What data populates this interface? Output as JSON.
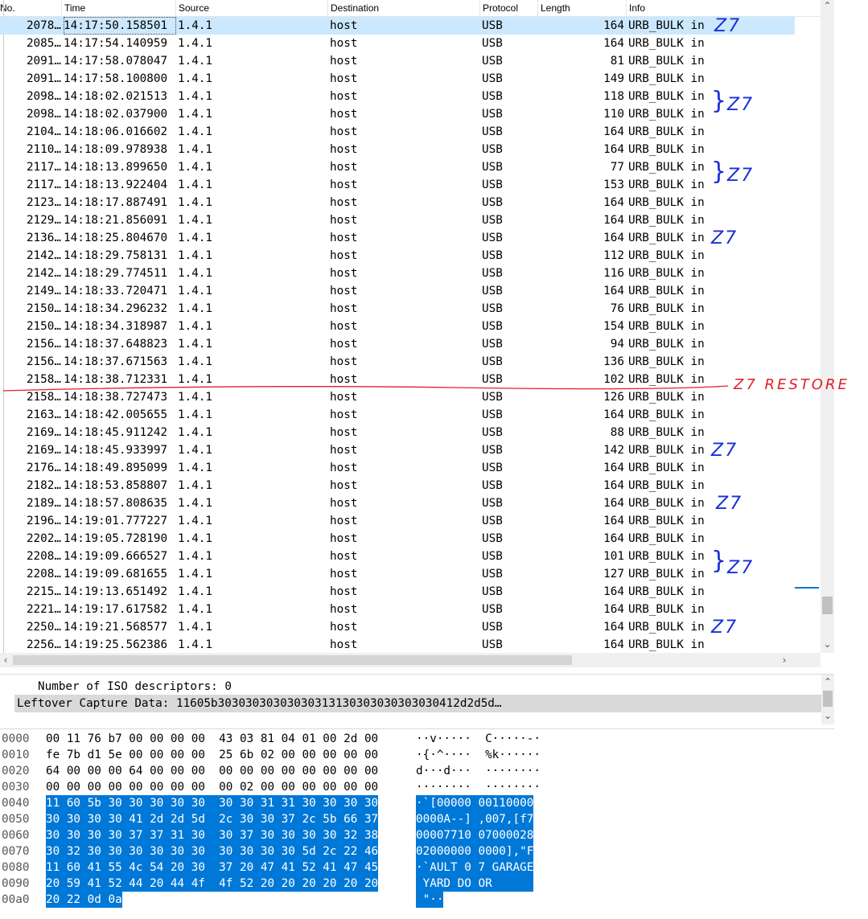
{
  "columns": {
    "no": "No.",
    "time": "Time",
    "source": "Source",
    "destination": "Destination",
    "protocol": "Protocol",
    "length": "Length",
    "info": "Info"
  },
  "packets": [
    {
      "no": "2078…",
      "time": "14:17:50.158501",
      "src": "1.4.1",
      "dst": "host",
      "proto": "USB",
      "len": "164",
      "info": "URB_BULK in"
    },
    {
      "no": "2085…",
      "time": "14:17:54.140959",
      "src": "1.4.1",
      "dst": "host",
      "proto": "USB",
      "len": "164",
      "info": "URB_BULK in"
    },
    {
      "no": "2091…",
      "time": "14:17:58.078047",
      "src": "1.4.1",
      "dst": "host",
      "proto": "USB",
      "len": "81",
      "info": "URB_BULK in"
    },
    {
      "no": "2091…",
      "time": "14:17:58.100800",
      "src": "1.4.1",
      "dst": "host",
      "proto": "USB",
      "len": "149",
      "info": "URB_BULK in"
    },
    {
      "no": "2098…",
      "time": "14:18:02.021513",
      "src": "1.4.1",
      "dst": "host",
      "proto": "USB",
      "len": "118",
      "info": "URB_BULK in"
    },
    {
      "no": "2098…",
      "time": "14:18:02.037900",
      "src": "1.4.1",
      "dst": "host",
      "proto": "USB",
      "len": "110",
      "info": "URB_BULK in"
    },
    {
      "no": "2104…",
      "time": "14:18:06.016602",
      "src": "1.4.1",
      "dst": "host",
      "proto": "USB",
      "len": "164",
      "info": "URB_BULK in"
    },
    {
      "no": "2110…",
      "time": "14:18:09.978938",
      "src": "1.4.1",
      "dst": "host",
      "proto": "USB",
      "len": "164",
      "info": "URB_BULK in"
    },
    {
      "no": "2117…",
      "time": "14:18:13.899650",
      "src": "1.4.1",
      "dst": "host",
      "proto": "USB",
      "len": "77",
      "info": "URB_BULK in"
    },
    {
      "no": "2117…",
      "time": "14:18:13.922404",
      "src": "1.4.1",
      "dst": "host",
      "proto": "USB",
      "len": "153",
      "info": "URB_BULK in"
    },
    {
      "no": "2123…",
      "time": "14:18:17.887491",
      "src": "1.4.1",
      "dst": "host",
      "proto": "USB",
      "len": "164",
      "info": "URB_BULK in"
    },
    {
      "no": "2129…",
      "time": "14:18:21.856091",
      "src": "1.4.1",
      "dst": "host",
      "proto": "USB",
      "len": "164",
      "info": "URB_BULK in"
    },
    {
      "no": "2136…",
      "time": "14:18:25.804670",
      "src": "1.4.1",
      "dst": "host",
      "proto": "USB",
      "len": "164",
      "info": "URB_BULK in"
    },
    {
      "no": "2142…",
      "time": "14:18:29.758131",
      "src": "1.4.1",
      "dst": "host",
      "proto": "USB",
      "len": "112",
      "info": "URB_BULK in"
    },
    {
      "no": "2142…",
      "time": "14:18:29.774511",
      "src": "1.4.1",
      "dst": "host",
      "proto": "USB",
      "len": "116",
      "info": "URB_BULK in"
    },
    {
      "no": "2149…",
      "time": "14:18:33.720471",
      "src": "1.4.1",
      "dst": "host",
      "proto": "USB",
      "len": "164",
      "info": "URB_BULK in"
    },
    {
      "no": "2150…",
      "time": "14:18:34.296232",
      "src": "1.4.1",
      "dst": "host",
      "proto": "USB",
      "len": "76",
      "info": "URB_BULK in"
    },
    {
      "no": "2150…",
      "time": "14:18:34.318987",
      "src": "1.4.1",
      "dst": "host",
      "proto": "USB",
      "len": "154",
      "info": "URB_BULK in"
    },
    {
      "no": "2156…",
      "time": "14:18:37.648823",
      "src": "1.4.1",
      "dst": "host",
      "proto": "USB",
      "len": "94",
      "info": "URB_BULK in"
    },
    {
      "no": "2156…",
      "time": "14:18:37.671563",
      "src": "1.4.1",
      "dst": "host",
      "proto": "USB",
      "len": "136",
      "info": "URB_BULK in"
    },
    {
      "no": "2158…",
      "time": "14:18:38.712331",
      "src": "1.4.1",
      "dst": "host",
      "proto": "USB",
      "len": "102",
      "info": "URB_BULK in"
    },
    {
      "no": "2158…",
      "time": "14:18:38.727473",
      "src": "1.4.1",
      "dst": "host",
      "proto": "USB",
      "len": "126",
      "info": "URB_BULK in"
    },
    {
      "no": "2163…",
      "time": "14:18:42.005655",
      "src": "1.4.1",
      "dst": "host",
      "proto": "USB",
      "len": "164",
      "info": "URB_BULK in"
    },
    {
      "no": "2169…",
      "time": "14:18:45.911242",
      "src": "1.4.1",
      "dst": "host",
      "proto": "USB",
      "len": "88",
      "info": "URB_BULK in"
    },
    {
      "no": "2169…",
      "time": "14:18:45.933997",
      "src": "1.4.1",
      "dst": "host",
      "proto": "USB",
      "len": "142",
      "info": "URB_BULK in"
    },
    {
      "no": "2176…",
      "time": "14:18:49.895099",
      "src": "1.4.1",
      "dst": "host",
      "proto": "USB",
      "len": "164",
      "info": "URB_BULK in"
    },
    {
      "no": "2182…",
      "time": "14:18:53.858807",
      "src": "1.4.1",
      "dst": "host",
      "proto": "USB",
      "len": "164",
      "info": "URB_BULK in"
    },
    {
      "no": "2189…",
      "time": "14:18:57.808635",
      "src": "1.4.1",
      "dst": "host",
      "proto": "USB",
      "len": "164",
      "info": "URB_BULK in"
    },
    {
      "no": "2196…",
      "time": "14:19:01.777227",
      "src": "1.4.1",
      "dst": "host",
      "proto": "USB",
      "len": "164",
      "info": "URB_BULK in"
    },
    {
      "no": "2202…",
      "time": "14:19:05.728190",
      "src": "1.4.1",
      "dst": "host",
      "proto": "USB",
      "len": "164",
      "info": "URB_BULK in"
    },
    {
      "no": "2208…",
      "time": "14:19:09.666527",
      "src": "1.4.1",
      "dst": "host",
      "proto": "USB",
      "len": "101",
      "info": "URB_BULK in"
    },
    {
      "no": "2208…",
      "time": "14:19:09.681655",
      "src": "1.4.1",
      "dst": "host",
      "proto": "USB",
      "len": "127",
      "info": "URB_BULK in"
    },
    {
      "no": "2215…",
      "time": "14:19:13.651492",
      "src": "1.4.1",
      "dst": "host",
      "proto": "USB",
      "len": "164",
      "info": "URB_BULK in"
    },
    {
      "no": "2221…",
      "time": "14:19:17.617582",
      "src": "1.4.1",
      "dst": "host",
      "proto": "USB",
      "len": "164",
      "info": "URB_BULK in"
    },
    {
      "no": "2250…",
      "time": "14:19:21.568577",
      "src": "1.4.1",
      "dst": "host",
      "proto": "USB",
      "len": "164",
      "info": "URB_BULK in"
    },
    {
      "no": "2256…",
      "time": "14:19:25.562386",
      "src": "1.4.1",
      "dst": "host",
      "proto": "USB",
      "len": "164",
      "info": "URB_BULK in"
    }
  ],
  "selected_row": 0,
  "annotations": {
    "z7": "Z7",
    "restore": "Z7 RESTORE",
    "brace": "}",
    "colors": {
      "blue": "#1a2fd6",
      "red": "#e0202a"
    }
  },
  "details": {
    "iso_descriptors": "Number of ISO descriptors: 0",
    "leftover": "Leftover Capture Data: 11605b30303030303030313130303030303030412d2d5d…"
  },
  "hex": [
    {
      "off": "0000",
      "hex": "00 11 76 b7 00 00 00 00  43 03 81 04 01 00 2d 00",
      "asc": "··v·····  C·····-·",
      "sel": false
    },
    {
      "off": "0010",
      "hex": "fe 7b d1 5e 00 00 00 00  25 6b 02 00 00 00 00 00",
      "asc": "·{·^····  %k······",
      "sel": false
    },
    {
      "off": "0020",
      "hex": "64 00 00 00 64 00 00 00  00 00 00 00 00 00 00 00",
      "asc": "d···d···  ········",
      "sel": false
    },
    {
      "off": "0030",
      "hex": "00 00 00 00 00 00 00 00  00 02 00 00 00 00 00 00",
      "asc": "········  ········",
      "sel": false
    },
    {
      "off": "0040",
      "hex": "11 60 5b 30 30 30 30 30  30 30 31 31 30 30 30 30",
      "asc": "·`[00000 00110000",
      "sel": true
    },
    {
      "off": "0050",
      "hex": "30 30 30 30 41 2d 2d 5d  2c 30 30 37 2c 5b 66 37",
      "asc": "0000A--] ,007,[f7",
      "sel": true
    },
    {
      "off": "0060",
      "hex": "30 30 30 30 37 37 31 30  30 37 30 30 30 30 32 38",
      "asc": "00007710 07000028",
      "sel": true
    },
    {
      "off": "0070",
      "hex": "30 32 30 30 30 30 30 30  30 30 30 30 5d 2c 22 46",
      "asc": "02000000 0000],\"F",
      "sel": true
    },
    {
      "off": "0080",
      "hex": "11 60 41 55 4c 54 20 30  37 20 47 41 52 41 47 45",
      "asc": "·`AULT 0 7 GARAGE",
      "sel": true
    },
    {
      "off": "0090",
      "hex": "20 59 41 52 44 20 44 4f  4f 52 20 20 20 20 20 20",
      "asc": " YARD DO OR      ",
      "sel": true
    },
    {
      "off": "00a0",
      "hex": "20 22 0d 0a",
      "asc": " \"··",
      "sel": true
    }
  ]
}
